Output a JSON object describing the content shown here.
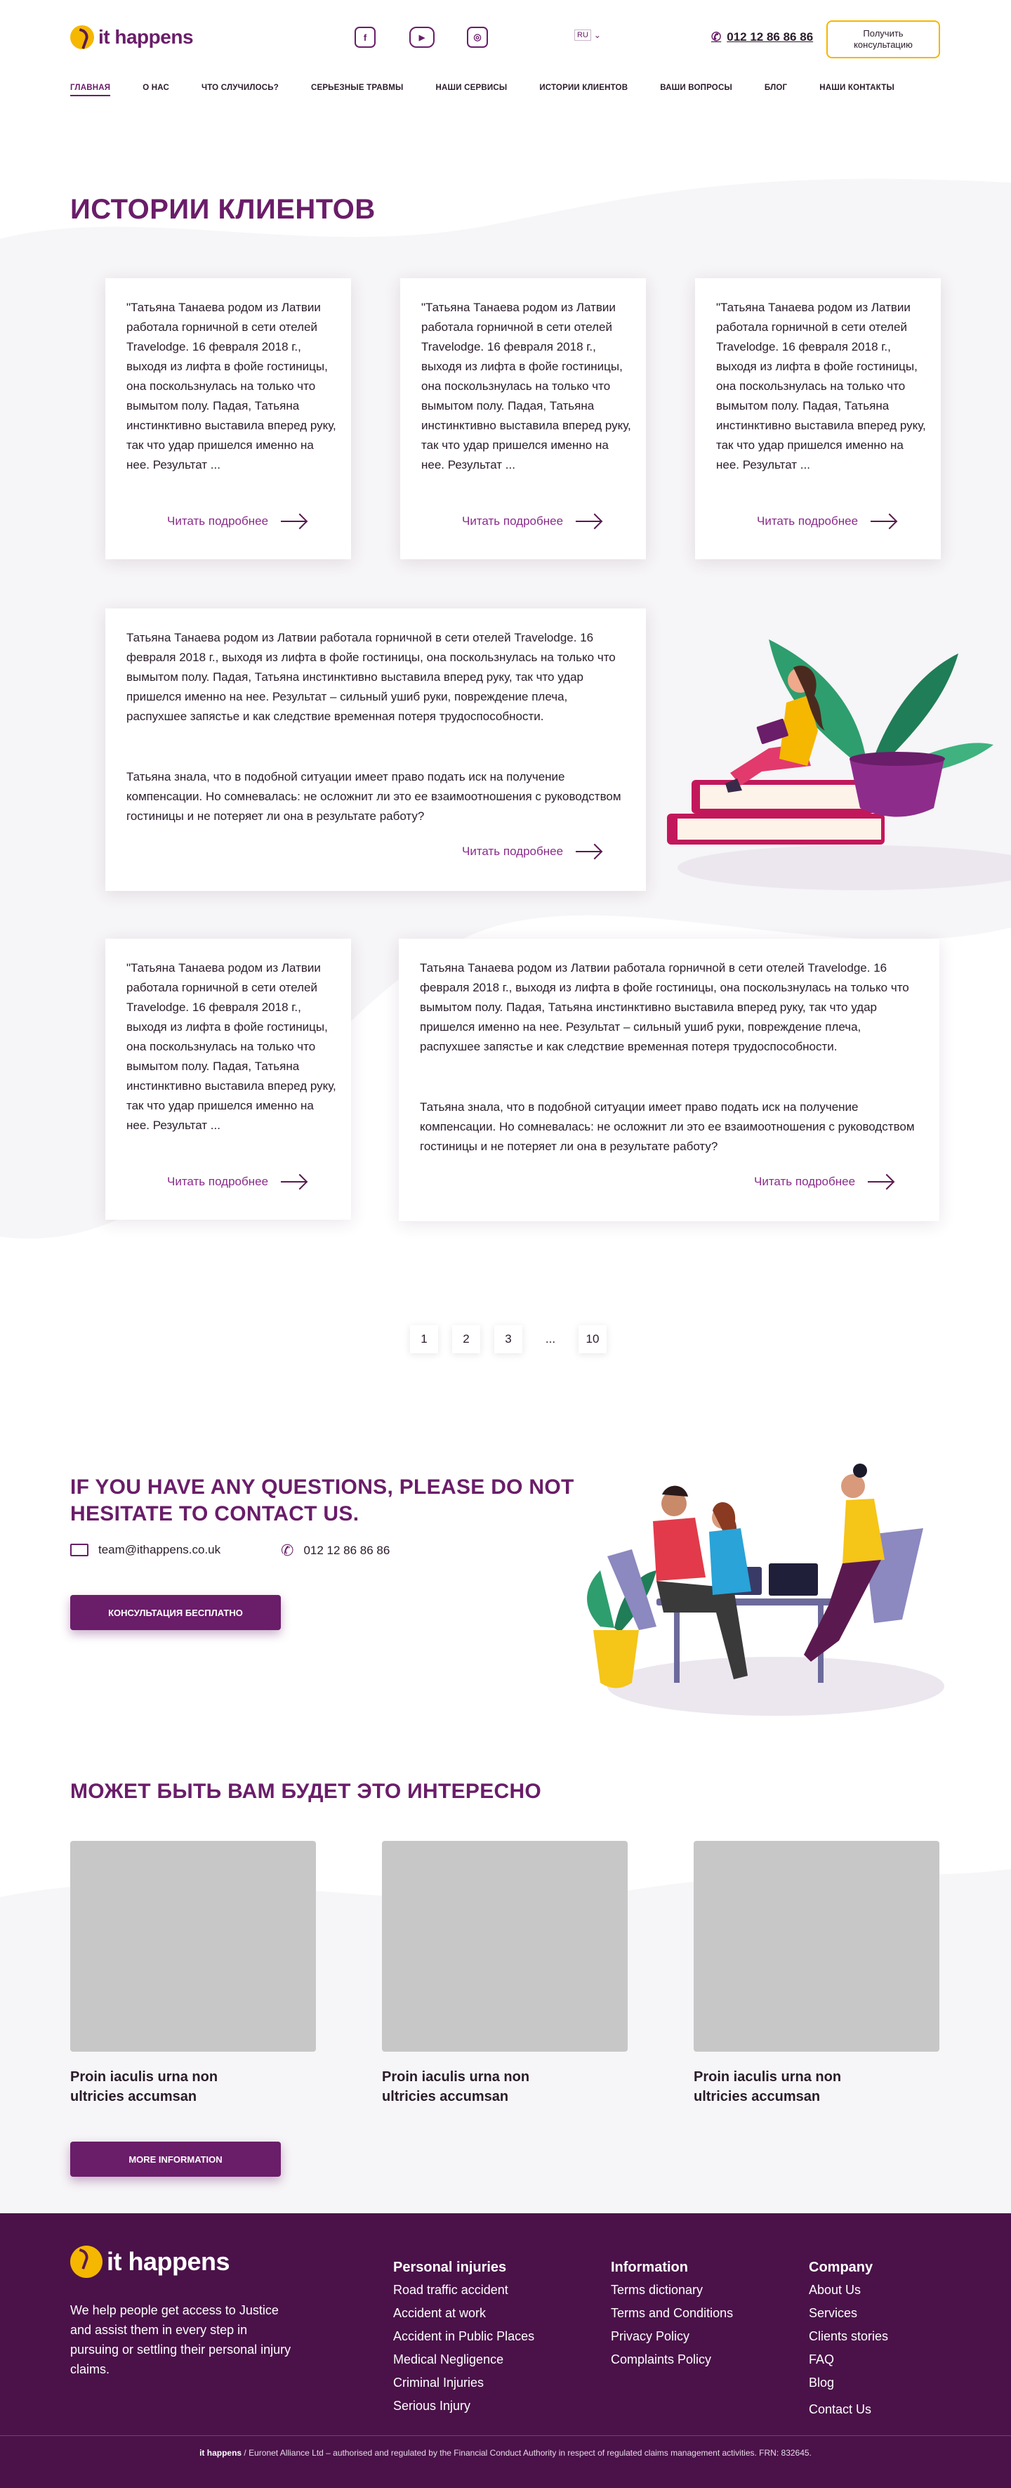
{
  "header": {
    "logo_text": "it happens",
    "social": [
      {
        "icon": "facebook-icon",
        "glyph": "f"
      },
      {
        "icon": "youtube-icon",
        "glyph": "▶"
      },
      {
        "icon": "instagram-icon",
        "glyph": "◎"
      }
    ],
    "lang": "RU",
    "phone": "012 12 86 86 86",
    "cta_line1": "Получить",
    "cta_line2": "консультацию"
  },
  "nav": [
    {
      "label": "ГЛАВНАЯ",
      "active": true
    },
    {
      "label": "О НАС"
    },
    {
      "label": "ЧТО СЛУЧИЛОСЬ?"
    },
    {
      "label": "СЕРЬЕЗНЫЕ ТРАВМЫ"
    },
    {
      "label": "НАШИ СЕРВИСЫ"
    },
    {
      "label": "ИСТОРИИ КЛИЕНТОВ"
    },
    {
      "label": "ВАШИ ВОПРОСЫ"
    },
    {
      "label": "БЛОГ"
    },
    {
      "label": "НАШИ КОНТАКТЫ"
    }
  ],
  "stories": {
    "title": "ИСТОРИИ КЛИЕНТОВ",
    "short_story": "\"Татьяна Танаева родом из Латвии работала горничной в сети отелей Travelodge. 16 февраля 2018 г., выходя из лифта в фойе гостиницы, она поскользнулась на только что вымытом полу. Падая, Татьяна инстинктивно выставила вперед руку, так что удар пришелся именно на нее. Результат ...",
    "long_p1": "Татьяна Танаева родом из Латвии работала горничной в сети отелей Travelodge. 16 февраля 2018 г., выходя из лифта в фойе гостиницы, она поскользнулась на только что вымытом полу. Падая, Татьяна инстинктивно выставила вперед руку, так что удар пришелся именно на нее. Результат – сильный ушиб руки, повреждение плеча, распухшее запястье и как следствие временная потеря трудоспособности.",
    "long_p2": "Татьяна знала, что в подобной ситуации имеет право подать иск на получение компенсации. Но сомневалась: не осложнит ли это ее взаимоотношения с руководством гостиницы и не потеряет ли она в результате работу?",
    "read_more": "Читать подробнее"
  },
  "pagination": [
    "1",
    "2",
    "3",
    "...",
    "10"
  ],
  "contact": {
    "title_line1": "IF YOU HAVE ANY QUESTIONS, PLEASE DO NOT",
    "title_line2": "HESITATE TO CONTACT US.",
    "email": "team@ithappens.co.uk",
    "phone": "012 12 86 86 86",
    "button": "КОНСУЛЬТАЦИЯ БЕСПЛАТНО"
  },
  "interesting": {
    "title": "МОЖЕТ БЫТЬ ВАМ БУДЕТ ЭТО ИНТЕРЕСНО",
    "items": [
      {
        "line1": "Proin iaculis urna non",
        "line2": "ultricies accumsan"
      },
      {
        "line1": "Proin iaculis urna non",
        "line2": "ultricies accumsan"
      },
      {
        "line1": "Proin iaculis urna non",
        "line2": "ultricies accumsan"
      }
    ],
    "button": "MORE INFORMATION"
  },
  "footer": {
    "logo_text": "it happens",
    "description": "We help people get access to Justice and assist them in every step in pursuing or settling their personal injury claims.",
    "col1": {
      "title": "Personal injuries",
      "links": [
        "Road traffic accident",
        "Accident at work",
        "Accident in Public Places",
        "Medical Negligence",
        "Criminal Injuries",
        "Serious Injury"
      ]
    },
    "col2": {
      "title": "Information",
      "links": [
        "Terms dictionary",
        "Terms and Conditions",
        "Privacy Policy",
        "Complaints Policy"
      ]
    },
    "col3": {
      "title": "Company",
      "links": [
        "About Us",
        "Services",
        "Clients stories",
        "FAQ",
        "Blog",
        "Contact Us"
      ]
    },
    "copyright_brand": "it happens",
    "copyright_text": " / Euronet Alliance Ltd – authorised and regulated by the Financial Conduct Authority in respect of regulated claims management activities. FRN: 832645."
  }
}
